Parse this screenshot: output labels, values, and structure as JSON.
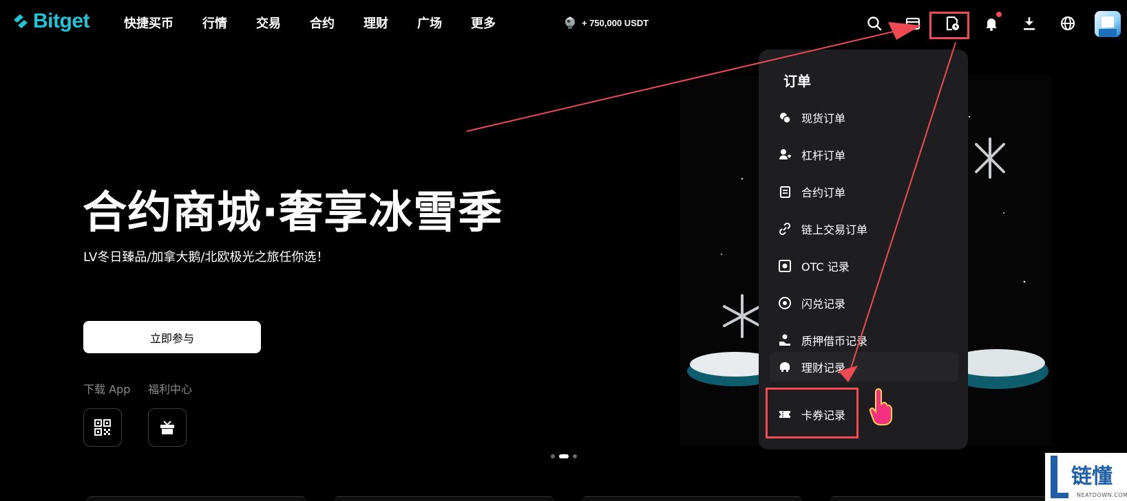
{
  "brand": {
    "name": "Bitget",
    "accent": "#1ec5d8"
  },
  "nav": {
    "items": [
      "快捷买币",
      "行情",
      "交易",
      "合约",
      "理财",
      "广场",
      "更多"
    ]
  },
  "promo": {
    "text": "+ 750,000 USDT"
  },
  "header_icons": [
    "search-icon",
    "wallet-icon",
    "orders-icon",
    "bell-icon",
    "download-icon",
    "globe-icon"
  ],
  "hero": {
    "title": "合约商城·奢享冰雪季",
    "subtitle": "LV冬日臻品/加拿大鹅/北欧极光之旅任你选！",
    "cta": "立即参与",
    "download_label": "下载 App",
    "welfare_label": "福利中心"
  },
  "carousel": {
    "count": 3,
    "active": 1
  },
  "orders_menu": {
    "title": "订单",
    "items": [
      {
        "label": "现货订单",
        "icon": "spot-order-icon"
      },
      {
        "label": "杠杆订单",
        "icon": "margin-order-icon"
      },
      {
        "label": "合约订单",
        "icon": "futures-order-icon"
      },
      {
        "label": "链上交易订单",
        "icon": "onchain-order-icon"
      },
      {
        "label": "OTC 记录",
        "icon": "otc-record-icon"
      },
      {
        "label": "闪兑记录",
        "icon": "convert-record-icon"
      },
      {
        "label": "质押借币记录",
        "icon": "loan-record-icon"
      },
      {
        "label": "理财记录",
        "icon": "earn-record-icon"
      },
      {
        "label": "卡券记录",
        "icon": "coupon-record-icon"
      }
    ]
  },
  "watermark": {
    "text": "链懂",
    "sub": "NEATDOWN.COM"
  },
  "colors": {
    "highlight": "#f04b55",
    "menu_bg": "#1e1e20",
    "notify": "#f6465d"
  }
}
